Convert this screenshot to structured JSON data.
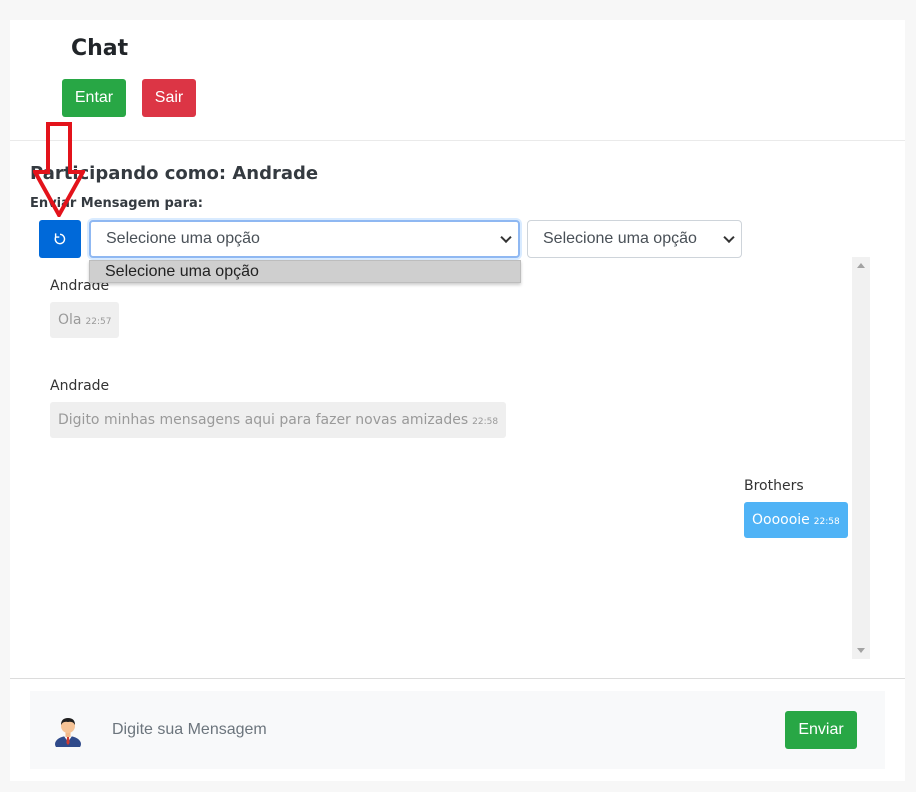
{
  "header": {
    "title": "Chat",
    "enter_label": "Entar",
    "exit_label": "Sair"
  },
  "session": {
    "participating_label": "Participando como:",
    "username": "Andrade",
    "send_to_label": "Enviar Mensagem para:"
  },
  "selects": {
    "primary_value": "Selecione uma opção",
    "secondary_value": "Selecione uma opção",
    "dropdown_option": "Selecione uma opção"
  },
  "messages": [
    {
      "sender": "Andrade",
      "text": "Ola",
      "time": "22:57",
      "direction": "in"
    },
    {
      "sender": "Andrade",
      "text": "Digito minhas mensagens aqui para fazer novas amizades",
      "time": "22:58",
      "direction": "in"
    },
    {
      "sender": "Brothers",
      "text": "Oooooie",
      "time": "22:58",
      "direction": "out"
    }
  ],
  "compose": {
    "placeholder": "Digite sua Mensagem",
    "send_label": "Enviar"
  },
  "icons": {
    "refresh": "refresh-icon",
    "avatar": "avatar-icon",
    "annotation": "red-down-arrow"
  },
  "colors": {
    "success": "#28a745",
    "danger": "#dc3545",
    "primary": "#0069d9",
    "bubble_out": "#4fb3f6",
    "bubble_in": "#efefef",
    "annotation": "#e3131b"
  }
}
